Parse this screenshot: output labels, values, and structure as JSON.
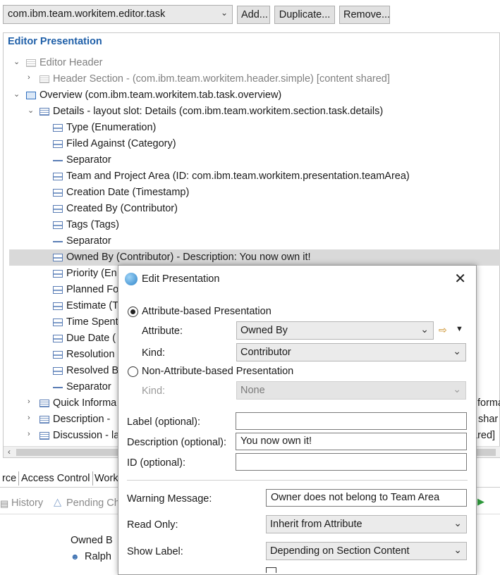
{
  "toolbar": {
    "editor_combo_value": "com.ibm.team.workitem.editor.task",
    "add_label": "Add...",
    "duplicate_label": "Duplicate...",
    "remove_label": "Remove..."
  },
  "panel": {
    "title": "Editor Presentation",
    "rows": [
      "Editor Header",
      "Header Section - (com.ibm.team.workitem.header.simple) [content shared]",
      "Overview (com.ibm.team.workitem.tab.task.overview)",
      "Details - layout slot: Details (com.ibm.team.workitem.section.task.details)",
      "Type (Enumeration)",
      "Filed Against (Category)",
      "Separator",
      "Team and Project Area (ID: com.ibm.team.workitem.presentation.teamArea)",
      "Creation Date (Timestamp)",
      "Created By (Contributor)",
      "Tags (Tags)",
      "Separator",
      "Owned By (Contributor) - Description: You now own it!",
      "Priority (En",
      "Planned Fo",
      "Estimate (T",
      "Time Spent",
      "Due Date (",
      "Resolution",
      "Resolved B",
      "Separator",
      "Quick Informa",
      "Description -",
      "Discussion - la"
    ],
    "right_cut": [
      "forma",
      "shar",
      "ared]"
    ]
  },
  "bottom_tabs": [
    "rce",
    "Access Control",
    "Work"
  ],
  "history": {
    "history_label": "History",
    "pending_label": "Pending Ch"
  },
  "owned_panel": {
    "header": "Owned B",
    "value": "Ralph"
  },
  "dialog": {
    "title": "Edit Presentation",
    "attr_based_label": "Attribute-based Presentation",
    "attribute_label": "Attribute:",
    "attribute_value": "Owned By",
    "kind_label": "Kind:",
    "kind_value": "Contributor",
    "non_attr_label": "Non-Attribute-based Presentation",
    "non_kind_label": "Kind:",
    "non_kind_value": "None",
    "label_label": "Label (optional):",
    "label_value": "",
    "description_label": "Description (optional):",
    "description_value": "You now own it!",
    "id_label": "ID (optional):",
    "id_value": "",
    "warning_label": "Warning Message:",
    "warning_value": "Owner does not belong to Team Area",
    "readonly_label": "Read Only:",
    "readonly_value": "Inherit from Attribute",
    "showlabel_label": "Show Label:",
    "showlabel_value": "Depending on Section Content"
  }
}
